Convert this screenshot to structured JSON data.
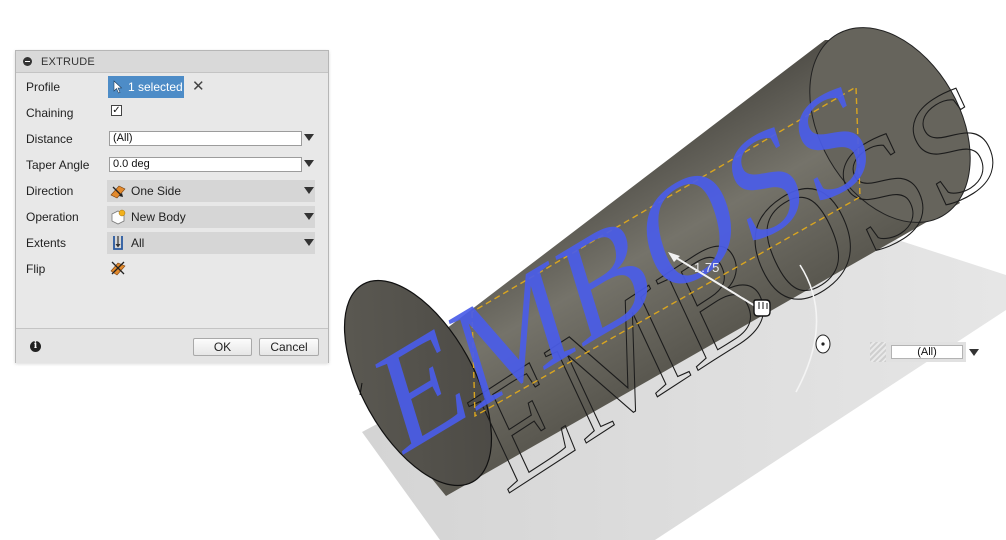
{
  "dialog": {
    "title": "EXTRUDE",
    "rows": {
      "profile": {
        "label": "Profile",
        "value": "1 selected"
      },
      "chaining": {
        "label": "Chaining",
        "checked": true
      },
      "distance": {
        "label": "Distance",
        "value": "(All)"
      },
      "taper": {
        "label": "Taper Angle",
        "value": "0.0 deg"
      },
      "direction": {
        "label": "Direction",
        "value": "One Side"
      },
      "operation": {
        "label": "Operation",
        "value": "New Body"
      },
      "extents": {
        "label": "Extents",
        "value": "All"
      },
      "flip": {
        "label": "Flip"
      }
    },
    "buttons": {
      "ok": "OK",
      "cancel": "Cancel"
    }
  },
  "viewport": {
    "emboss_text": "EMBOSS",
    "dimension_label": "1.75",
    "distance_input": "(All)"
  },
  "colors": {
    "selection_blue": "#4d8cc7",
    "profile_text": "#4a5ce8",
    "dashed_outline": "#d9a520",
    "cylinder": "#6a6860"
  },
  "icons": {
    "profile": "cursor-icon",
    "direction": "direction-icon",
    "operation": "new-body-icon",
    "extents": "extents-icon",
    "flip": "flip-icon",
    "info": "info-icon",
    "collapse": "collapse-icon"
  }
}
